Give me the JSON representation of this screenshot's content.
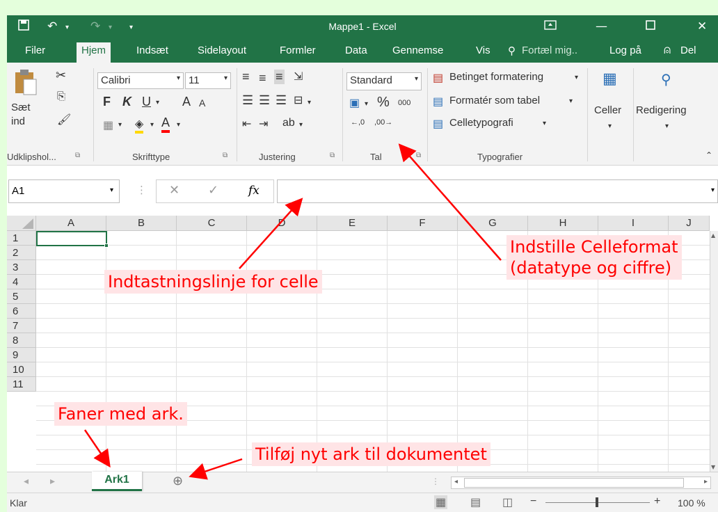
{
  "window": {
    "title": "Mappe1 - Excel"
  },
  "menu": {
    "items": [
      "Filer",
      "Hjem",
      "Indsæt",
      "Sidelayout",
      "Formler",
      "Data",
      "Gennemse",
      "Vis"
    ],
    "tell_me": "Fortæl mig..",
    "login": "Log på",
    "share": "Del"
  },
  "ribbon": {
    "clipboard": {
      "paste_line1": "Sæt",
      "paste_line2": "ind",
      "label": "Udklipshol..."
    },
    "font": {
      "name": "Calibri",
      "size": "11",
      "bold": "F",
      "italic": "K",
      "underline": "U",
      "grow": "A",
      "shrink": "A",
      "label": "Skrifttype"
    },
    "alignment": {
      "label": "Justering"
    },
    "number": {
      "format": "Standard",
      "percent": "%",
      "thousands": "000",
      "label": "Tal"
    },
    "styles": {
      "conditional": "Betinget formatering",
      "table": "Formatér som tabel",
      "cellstyles": "Celletypografi",
      "label": "Typografier"
    },
    "cells": {
      "label": "Celler"
    },
    "editing": {
      "label": "Redigering"
    }
  },
  "formula_bar": {
    "name_box": "A1",
    "fx": "fx",
    "value": ""
  },
  "grid": {
    "columns": [
      "A",
      "B",
      "C",
      "D",
      "E",
      "F",
      "G",
      "H",
      "I",
      "J"
    ],
    "rows": [
      "1",
      "2",
      "3",
      "4",
      "5",
      "6",
      "7",
      "8",
      "9",
      "10",
      "11"
    ]
  },
  "sheets": {
    "active": "Ark1"
  },
  "status": {
    "ready": "Klar",
    "zoom": "100 %"
  },
  "annotations": {
    "formula": "Indtastningslinje for celle",
    "cellformat_line1": "Indstille Celleformat",
    "cellformat_line2": "(datatype og ciffre)",
    "tabs": "Faner med ark.",
    "addsheet": "Tilføj nyt ark til dokumentet"
  },
  "colors": {
    "excel_green": "#217346",
    "annotation_red": "#ff0000",
    "annotation_bg": "#ffe4e6",
    "outer_bg": "#e4ffdc"
  }
}
